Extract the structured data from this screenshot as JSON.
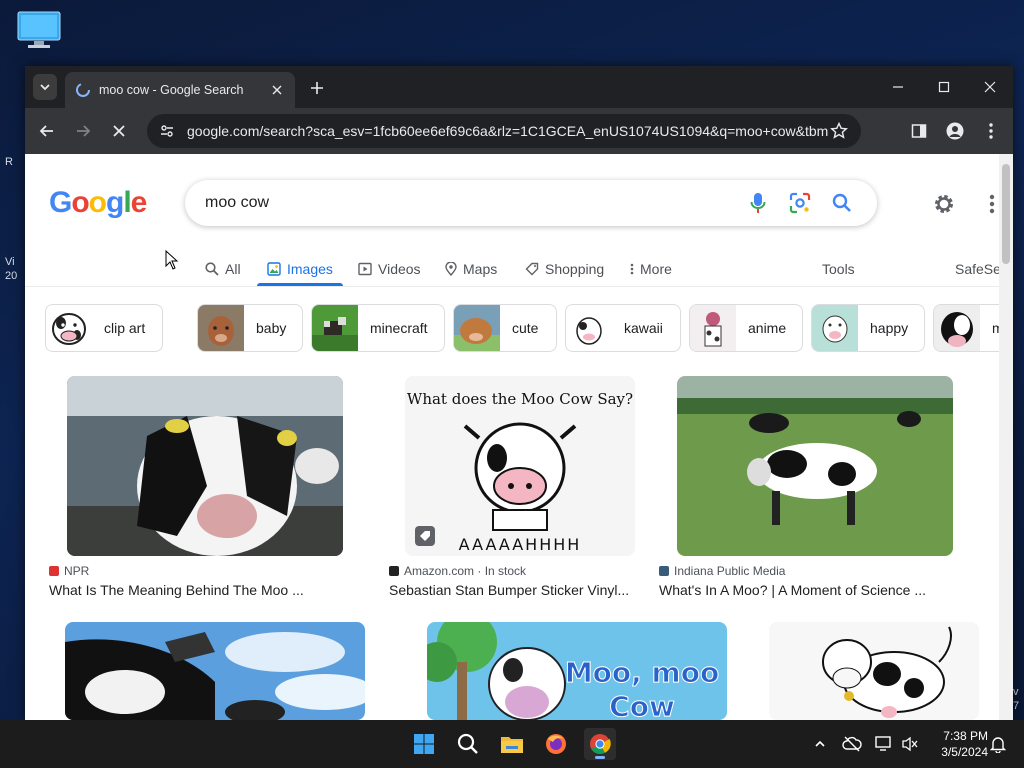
{
  "browser": {
    "tab_title": "moo cow - Google Search",
    "url": "google.com/search?sca_esv=1fcb60ee6ef69c6a&rlz=1C1GCEA_enUS1074US1094&q=moo+cow&tbm=isc..."
  },
  "google": {
    "logo_letters": [
      "G",
      "o",
      "o",
      "g",
      "l",
      "e"
    ],
    "logo_colors": [
      "#4285F4",
      "#EA4335",
      "#FBBC05",
      "#4285F4",
      "#34A853",
      "#EA4335"
    ],
    "query": "moo cow",
    "tabs": [
      "All",
      "Images",
      "Videos",
      "Maps",
      "Shopping",
      "More"
    ],
    "active_tab": "Images",
    "tools": "Tools",
    "safesearch": "SafeSe"
  },
  "chips": [
    "clip art",
    "baby",
    "minecraft",
    "cute",
    "kawaii",
    "anime",
    "happy",
    "milk"
  ],
  "results": [
    {
      "source": "NPR",
      "title": "What Is The Meaning Behind The Moo ..."
    },
    {
      "source": "Amazon.com · In stock",
      "title": "Sebastian Stan Bumper Sticker Vinyl..."
    },
    {
      "source": "Indiana Public Media",
      "title": "What's In A Moo? | A Moment of Science ..."
    }
  ],
  "image_text": {
    "sticker_top": "What does the Moo Cow Say?",
    "sticker_bottom": "AAAAAHHHH",
    "moo_moo": "Moo, moo",
    "moo_cow": "Cow"
  },
  "taskbar": {
    "time": "7:38 PM",
    "date": "3/5/2024"
  },
  "desktop": {
    "frag1": "R",
    "frag2": "Vi",
    "frag3": "20",
    "frag4": "v",
    "frag5": "7"
  }
}
